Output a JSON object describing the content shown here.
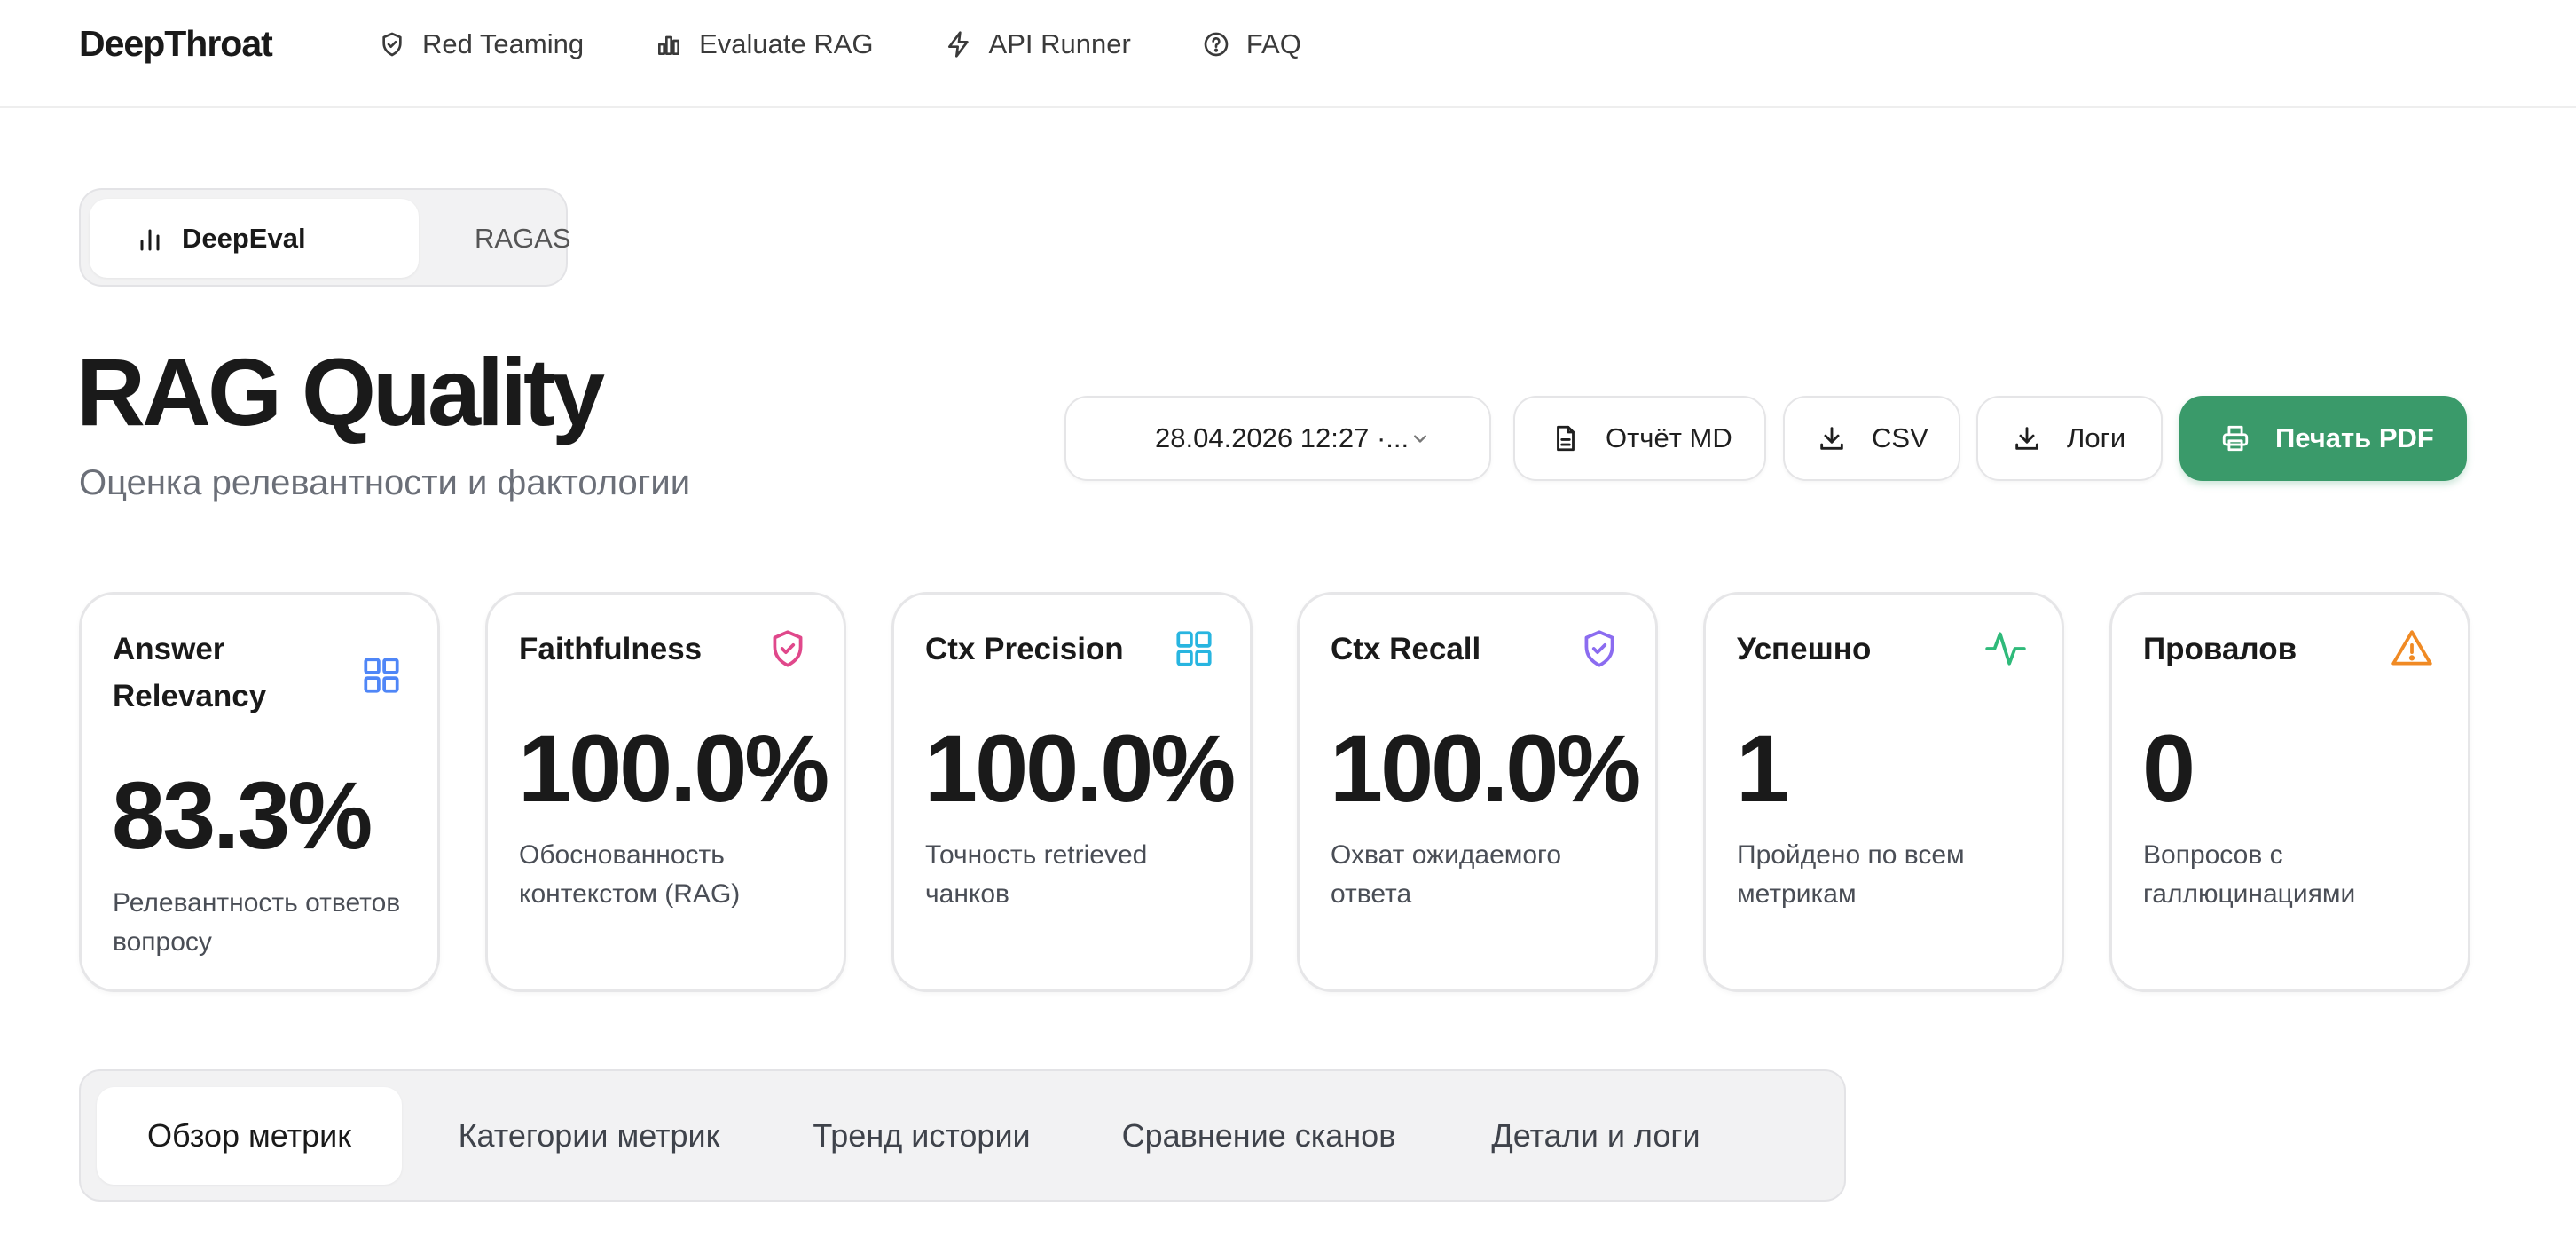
{
  "app": {
    "brand": "DeepThroat"
  },
  "nav": [
    {
      "label": "Red Teaming",
      "icon": "shield-icon"
    },
    {
      "label": "Evaluate RAG",
      "icon": "bar-chart-icon"
    },
    {
      "label": "API Runner",
      "icon": "lightning-icon"
    },
    {
      "label": "FAQ",
      "icon": "help-circle-icon"
    }
  ],
  "framework_toggle": {
    "options": [
      {
        "label": "DeepEval",
        "icon": "bar-chart-icon",
        "active": true
      },
      {
        "label": "RAGAS",
        "icon": "flask-icon",
        "active": false
      }
    ]
  },
  "header": {
    "title": "RAG Quality",
    "subtitle": "Оценка релевантности и фактологии"
  },
  "actions": {
    "run_select": "28.04.2026 12:27 ·...",
    "report_md": "Отчёт MD",
    "csv": "CSV",
    "logs": "Логи",
    "print_pdf": "Печать PDF"
  },
  "cards": [
    {
      "title": "Answer Relevancy",
      "value": "83.3%",
      "desc": "Релевантность ответов вопросу",
      "icon": "grid-icon",
      "color": "#4f86f7"
    },
    {
      "title": "Faithfulness",
      "value": "100.0%",
      "desc": "Обоснованность контекстом (RAG)",
      "icon": "shield-check-icon",
      "color": "#e0488b"
    },
    {
      "title": "Ctx Precision",
      "value": "100.0%",
      "desc": "Точность retrieved чанков",
      "icon": "grid-icon",
      "color": "#28b5e0"
    },
    {
      "title": "Ctx Recall",
      "value": "100.0%",
      "desc": "Охват ожидаемого ответа",
      "icon": "shield-check-icon",
      "color": "#8b6cf0"
    },
    {
      "title": "Успешно",
      "value": "1",
      "desc": "Пройдено по всем метрикам",
      "icon": "activity-icon",
      "color": "#2fba7a"
    },
    {
      "title": "Провалов",
      "value": "0",
      "desc": "Вопросов с галлюцинациями",
      "icon": "warning-icon",
      "color": "#f08a24"
    }
  ],
  "tabs": [
    {
      "label": "Обзор метрик",
      "active": true
    },
    {
      "label": "Категории метрик",
      "active": false
    },
    {
      "label": "Тренд истории",
      "active": false
    },
    {
      "label": "Сравнение сканов",
      "active": false
    },
    {
      "label": "Детали и логи",
      "active": false
    }
  ]
}
